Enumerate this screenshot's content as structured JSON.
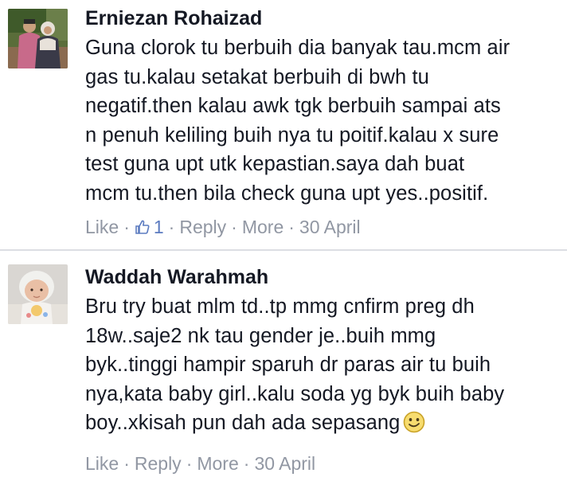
{
  "comments": [
    {
      "author": "Erniezan Rohaizad",
      "text_lines": [
        "Guna clorok tu berbuih dia banyak tau.mcm air",
        "gas tu.kalau setakat berbuih di bwh tu",
        "negatif.then kalau awk tgk berbuih sampai ats",
        "n penuh keliling buih nya tu poitif.kalau x sure",
        "test guna upt utk kepastian.saya dah buat",
        "mcm tu.then bila check guna upt yes..positif."
      ],
      "actions": {
        "like_label": "Like",
        "like_count": "1",
        "reply_label": "Reply",
        "more_label": "More",
        "date": "30 April"
      },
      "avatar_icon": "couple-photo-avatar"
    },
    {
      "author": "Waddah Warahmah",
      "text_lines": [
        "Bru try buat mlm td..tp mmg cnfirm preg dh",
        "18w..saje2 nk tau gender je..buih mmg",
        "byk..tinggi hampir sparuh dr paras air tu buih",
        "nya,kata baby girl..kalu soda yg byk buih baby",
        "boy..xkisah pun dah ada sepasang"
      ],
      "emoji_icon": "smiley-emoji-icon",
      "actions": {
        "like_label": "Like",
        "reply_label": "Reply",
        "more_label": "More",
        "date": "30 April"
      },
      "avatar_icon": "baby-photo-avatar"
    }
  ],
  "colors": {
    "text": "#141823",
    "meta": "#9197a3",
    "like_accent": "#5b7bc0",
    "divider": "#dcdee3"
  }
}
